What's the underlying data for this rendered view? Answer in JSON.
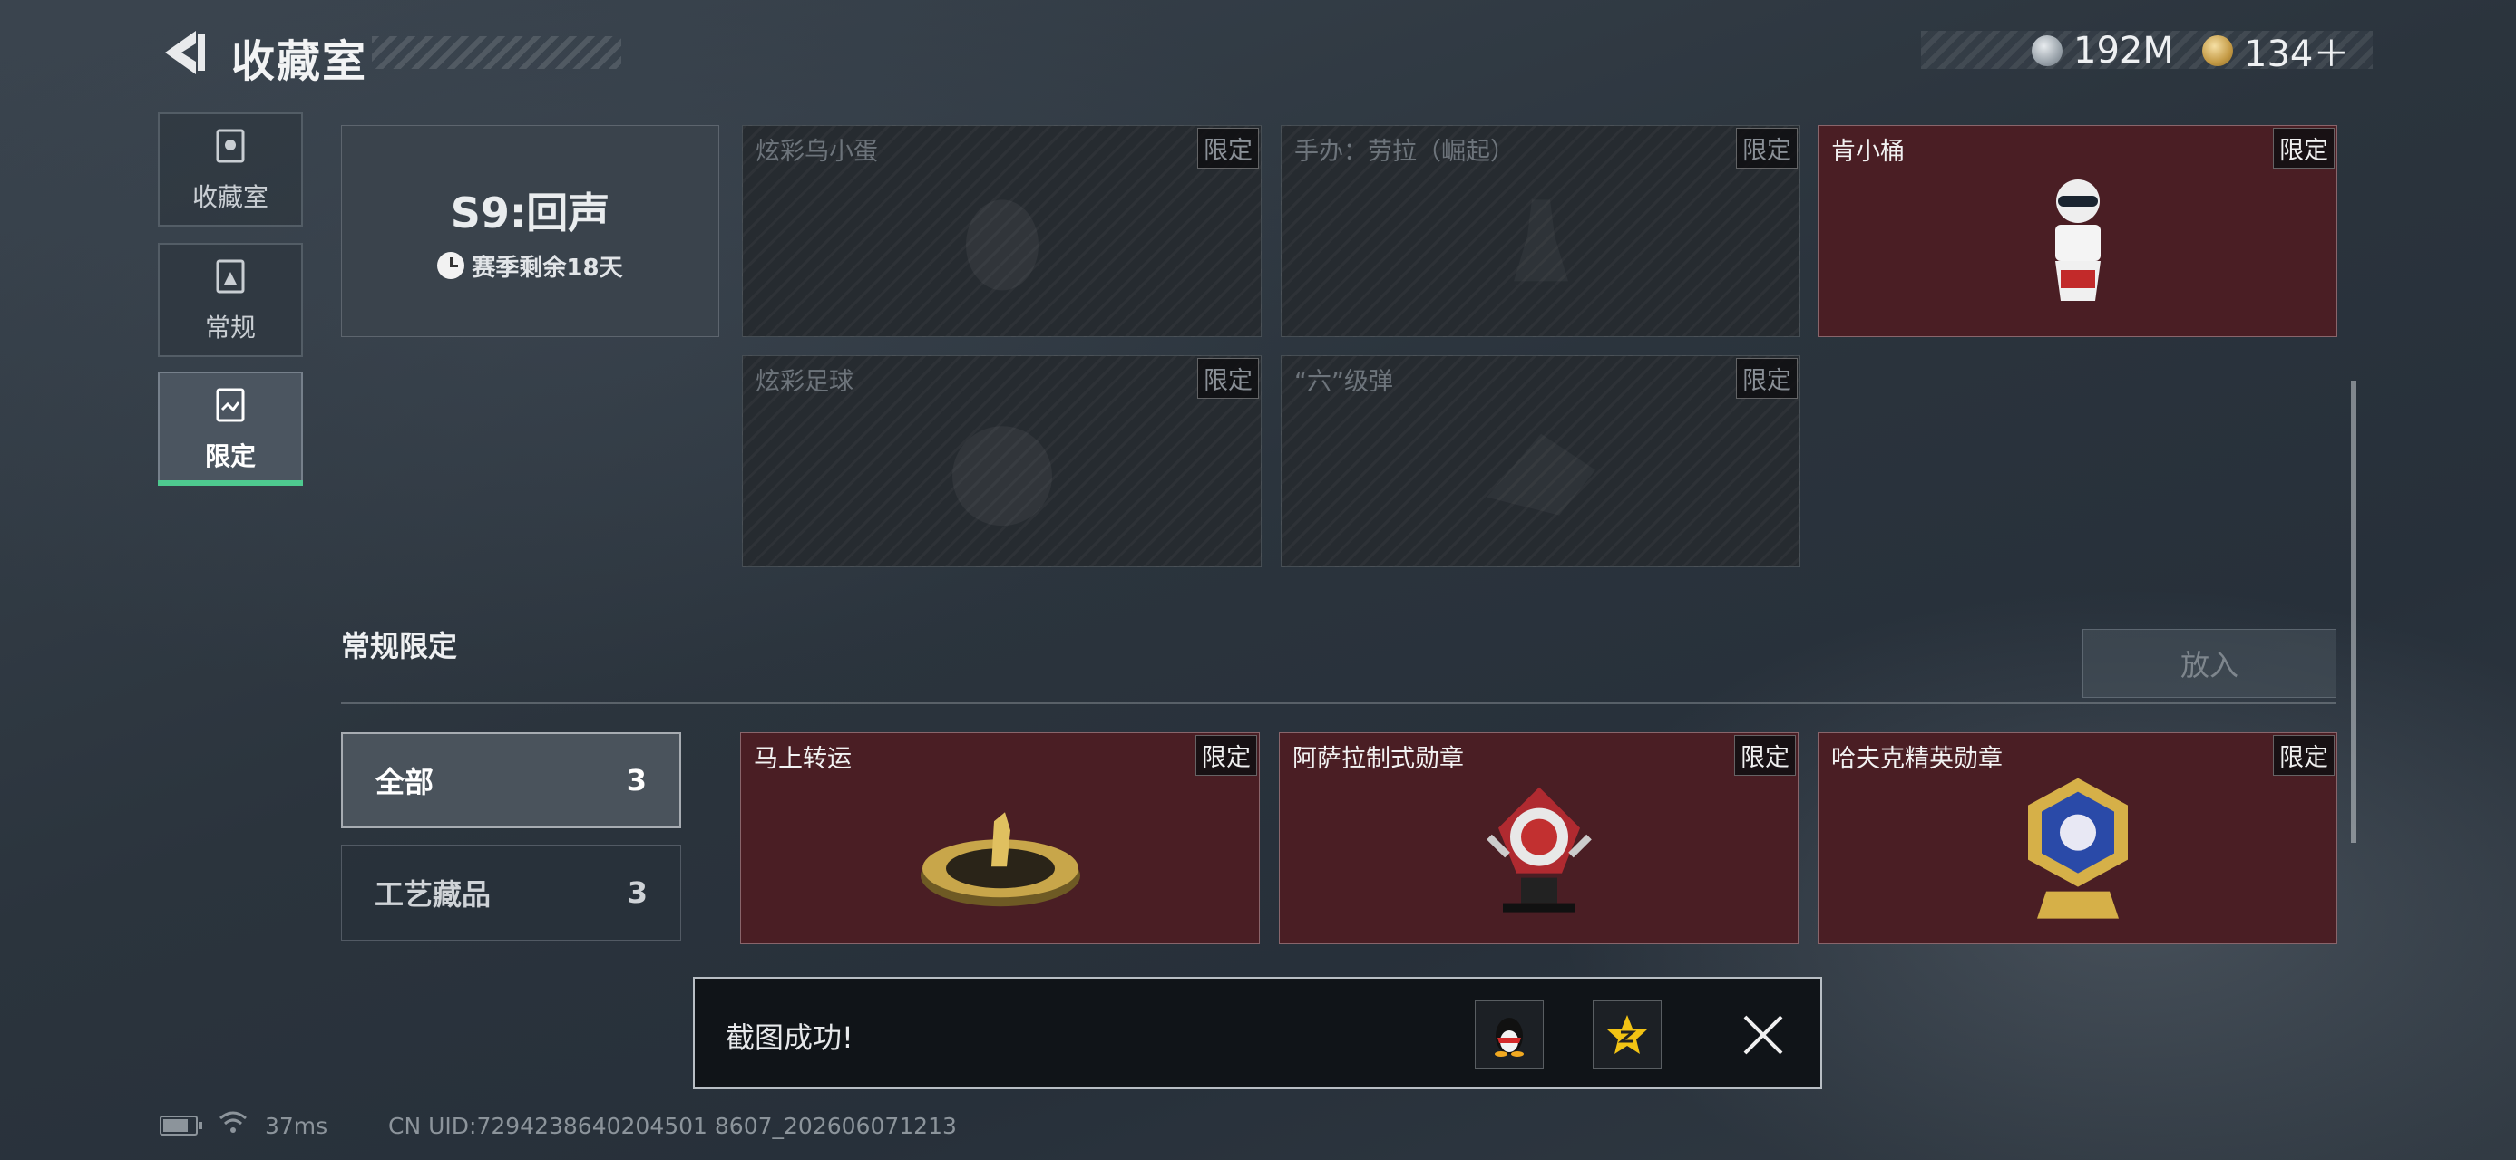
{
  "header": {
    "title": "收藏室",
    "currency": [
      {
        "icon": "silver-coin-icon",
        "amount": "192M"
      },
      {
        "icon": "gold-coin-icon",
        "amount": "134＋"
      }
    ]
  },
  "sidebar": {
    "items": [
      {
        "label": "收藏室",
        "icon": "collection-room-icon",
        "active": false
      },
      {
        "label": "常规",
        "icon": "regular-doc-icon",
        "active": false
      },
      {
        "label": "限定",
        "icon": "limited-icon",
        "active": true
      }
    ]
  },
  "season": {
    "title": "S9:回声",
    "remaining": "赛季剩余18天"
  },
  "season_items": [
    {
      "name": "炫彩乌小蛋",
      "tag": "限定",
      "owned": false
    },
    {
      "name": "手办：劳拉（崛起）",
      "tag": "限定",
      "owned": false
    },
    {
      "name": "肯小桶",
      "tag": "限定",
      "owned": true
    },
    {
      "name": "炫彩足球",
      "tag": "限定",
      "owned": false
    },
    {
      "name": "“六”级弹",
      "tag": "限定",
      "owned": false
    }
  ],
  "regular_limited": {
    "title": "常规限定",
    "put_button": "放入",
    "filters": [
      {
        "label": "全部",
        "count": "3",
        "active": true
      },
      {
        "label": "工艺藏品",
        "count": "3",
        "active": false
      }
    ],
    "items": [
      {
        "name": "马上转运",
        "tag": "限定"
      },
      {
        "name": "阿萨拉制式勋章",
        "tag": "限定"
      },
      {
        "name": "哈夫克精英勋章",
        "tag": "限定"
      }
    ]
  },
  "toast": {
    "message": "截图成功!",
    "share_icons": [
      "qq-penguin-icon",
      "qzone-star-icon"
    ]
  },
  "status_bar": {
    "ping": "37ms",
    "uid": "CN UID:7294238640204501 8607_202606071213",
    "battery_level": 0.8
  },
  "colors": {
    "accent_green": "#4ec98f",
    "owned_card_bg": "#4a1e24",
    "locked_card_bg": "#262b30"
  }
}
